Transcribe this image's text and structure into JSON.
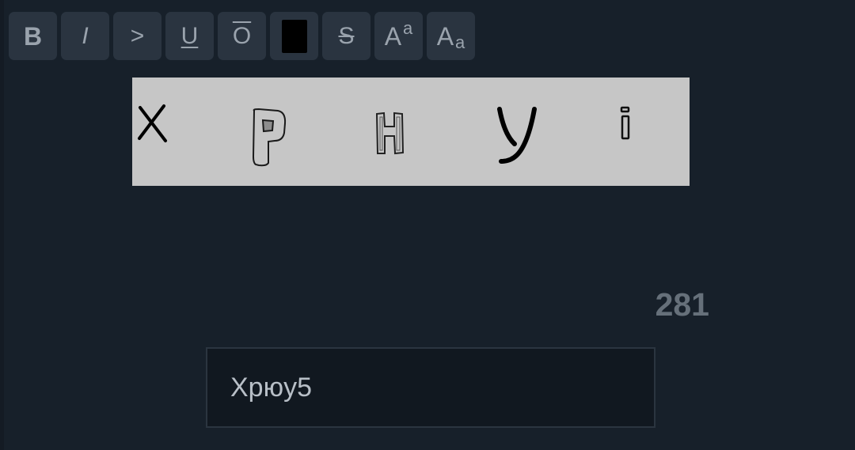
{
  "toolbar": {
    "bold_label": "B",
    "italic_label": "I",
    "quote_label": ">",
    "underline_label": "U",
    "overline_label": "O",
    "color_swatch": "#000000",
    "strike_label": "S",
    "superscript_big": "A",
    "superscript_small": "a",
    "subscript_big": "A",
    "subscript_small": "a"
  },
  "captcha": {
    "glyphs": [
      "X",
      "P",
      "H",
      "y",
      "i"
    ]
  },
  "counter": "281",
  "answer": {
    "value": "Хрюу5"
  }
}
